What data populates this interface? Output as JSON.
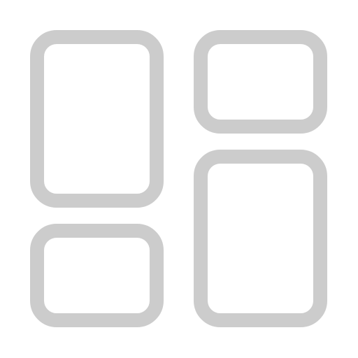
{
  "icon": {
    "name": "dashboard-layout-icon",
    "stroke_color": "#cccccc",
    "background_color": "#ffffff",
    "tiles": [
      {
        "name": "tile-top-left"
      },
      {
        "name": "tile-top-right"
      },
      {
        "name": "tile-bottom-left"
      },
      {
        "name": "tile-bottom-right"
      }
    ]
  }
}
